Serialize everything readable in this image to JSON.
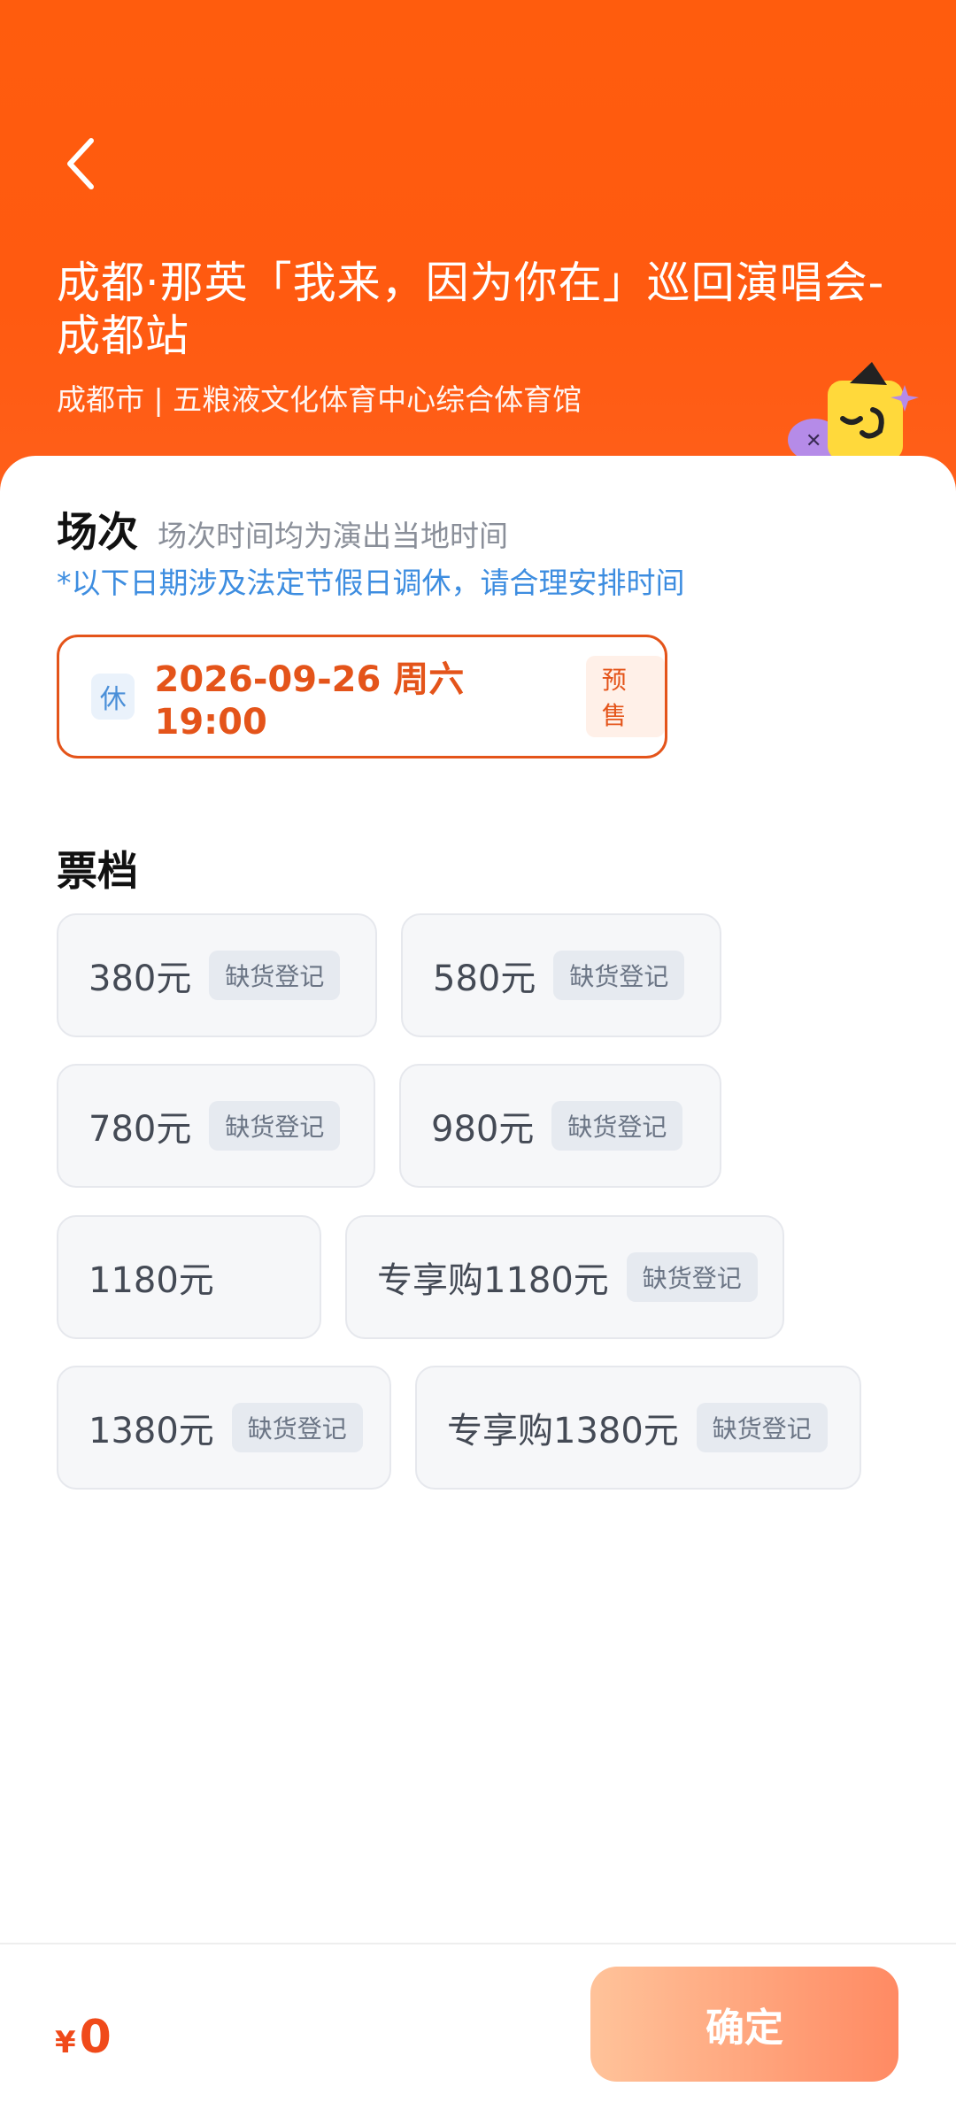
{
  "header": {
    "title": "成都·那英「我来，因为你在」巡回演唱会-成都站",
    "venue": "成都市 | 五粮液文化体育中心综合体育馆"
  },
  "session": {
    "section_title": "场次",
    "hint": "场次时间均为演出当地时间",
    "holiday_note": "*以下日期涉及法定节假日调休，请合理安排时间",
    "item": {
      "rest_tag": "休",
      "time": "2026-09-26 周六 19:00",
      "status": "预售"
    }
  },
  "tiers": {
    "section_title": "票档",
    "items": [
      {
        "price": "380元",
        "badge": "缺货登记"
      },
      {
        "price": "580元",
        "badge": "缺货登记"
      },
      {
        "price": "780元",
        "badge": "缺货登记"
      },
      {
        "price": "980元",
        "badge": "缺货登记"
      },
      {
        "price": "1180元",
        "badge": ""
      },
      {
        "price": "专享购1180元",
        "badge": "缺货登记"
      },
      {
        "price": "1380元",
        "badge": "缺货登记"
      },
      {
        "price": "专享购1380元",
        "badge": "缺货登记"
      }
    ]
  },
  "footer": {
    "currency": "¥",
    "total": "0",
    "confirm_label": "确定"
  },
  "colors": {
    "brand": "#ff5a0e",
    "accent": "#e4541a",
    "note_blue": "#3d8de0"
  },
  "icons": {
    "back": "chevron-left-icon",
    "mascot": "mascot-illustration"
  }
}
